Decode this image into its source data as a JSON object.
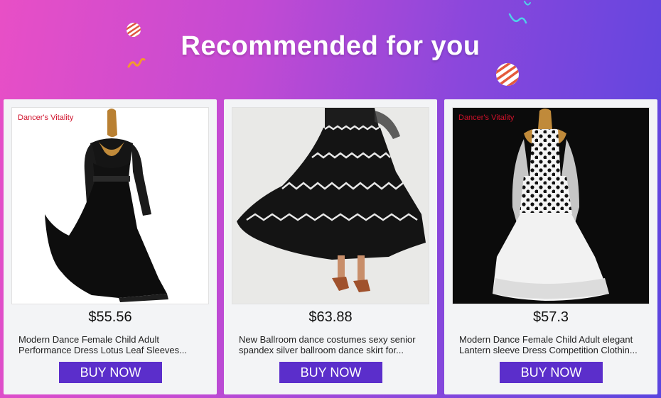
{
  "page": {
    "title": "Recommended for you"
  },
  "colors": {
    "accent": "#5b2ecb",
    "brand_text": "#d0112b"
  },
  "products": [
    {
      "image_icon": "black-dress-image",
      "brand": "Dancer's Vitality",
      "price": "$55.56",
      "description": "Modern Dance Female Child Adult Performance Dress Lotus Leaf Sleeves...",
      "button_label": "BUY NOW"
    },
    {
      "image_icon": "black-skirt-image",
      "price": "$63.88",
      "description": "New Ballroom dance costumes sexy senior spandex silver ballroom dance skirt for...",
      "button_label": "BUY NOW"
    },
    {
      "image_icon": "polka-dot-dress-image",
      "brand": "Dancer's Vitality",
      "price": "$57.3",
      "description": "Modern Dance Female Child Adult elegant Lantern sleeve Dress Competition Clothin...",
      "button_label": "BUY NOW"
    }
  ]
}
